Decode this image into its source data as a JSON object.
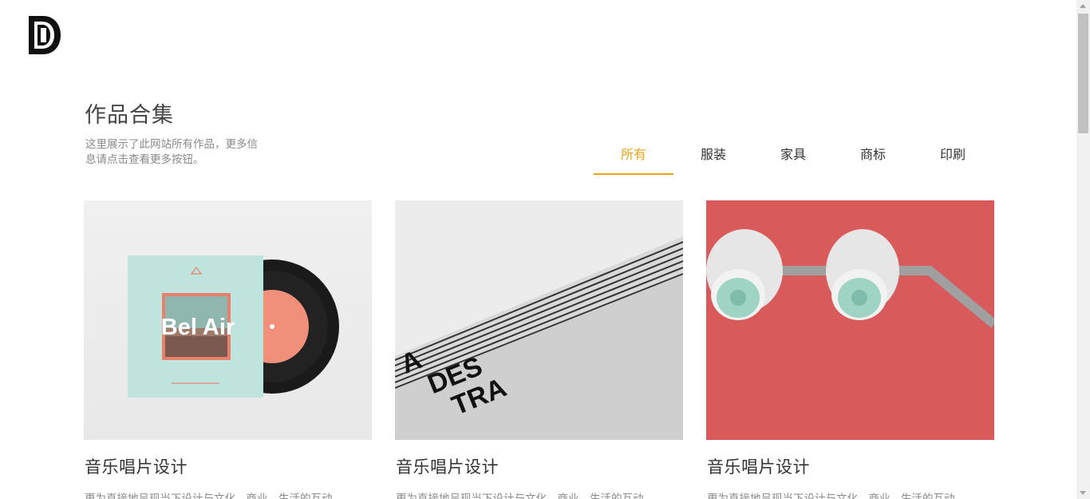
{
  "header": {
    "logo_icon": "brand-logo-icon"
  },
  "portfolio": {
    "title": "作品合集",
    "description": "这里展示了此网站所有作品，更多信息请点击查看更多按钮。",
    "filters": [
      {
        "label": "所有",
        "active": true
      },
      {
        "label": "服装",
        "active": false
      },
      {
        "label": "家具",
        "active": false
      },
      {
        "label": "商标",
        "active": false
      },
      {
        "label": "印刷",
        "active": false
      }
    ],
    "items": [
      {
        "title": "音乐唱片设计",
        "description": "更为直接地呈现当下设计与文化、商业、生活的互动",
        "image_text": "Bel Air"
      },
      {
        "title": "音乐唱片设计",
        "description": "更为直接地呈现当下设计与文化、商业、生活的互动",
        "image_text": [
          "A",
          "DES",
          "TRA"
        ]
      },
      {
        "title": "音乐唱片设计",
        "description": "更为直接地呈现当下设计与文化、商业、生活的互动"
      }
    ]
  },
  "colors": {
    "accent": "#e8a317",
    "text": "#333333",
    "muted": "#8a8a8a",
    "red_bg": "#d85a5a"
  }
}
